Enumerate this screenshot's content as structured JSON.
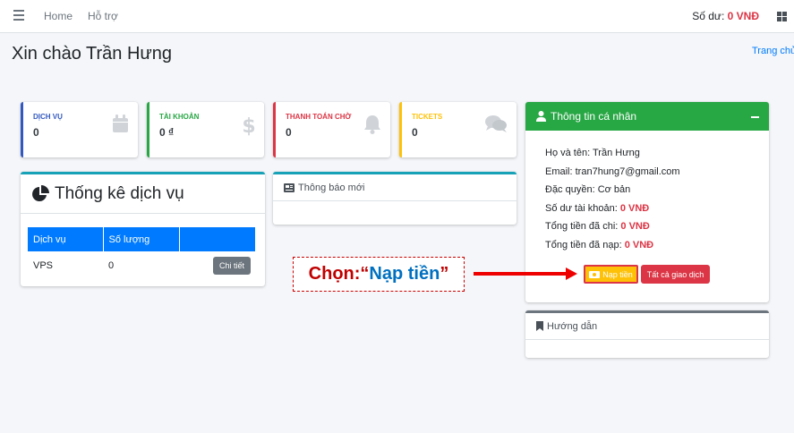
{
  "navbar": {
    "menu_icon": "hamburger-icon",
    "links": [
      "Home",
      "Hỗ trợ"
    ],
    "balance_label": "Số dư:",
    "balance_value": "0 VNĐ",
    "apps_icon": "grid-icon"
  },
  "page": {
    "title": "Xin chào Trần Hưng",
    "breadcrumb": "Trang chủ"
  },
  "stats": [
    {
      "label": "DỊCH VỤ",
      "value": "0",
      "color": "#3359c0",
      "icon": "calendar-icon"
    },
    {
      "label": "TÀI KHOẢN",
      "value": "0 ₫",
      "color": "#28a745",
      "icon": "dollar-icon"
    },
    {
      "label": "THANH TOÁN CHỜ",
      "value": "0",
      "color": "#dc3545",
      "icon": "bell-icon"
    },
    {
      "label": "TICKETS",
      "value": "0",
      "color": "#ffc107",
      "icon": "comments-icon"
    }
  ],
  "services": {
    "title": "Thống kê dịch vụ",
    "icon": "pie-chart-icon",
    "columns": [
      "Dịch vụ",
      "Số lượng",
      ""
    ],
    "rows": [
      {
        "name": "VPS",
        "count": "0",
        "action": "Chi tiết"
      }
    ]
  },
  "news": {
    "title": "Thông báo mới",
    "icon": "newspaper-icon"
  },
  "guide": {
    "title": "Hướng dẫn",
    "icon": "bookmark-icon"
  },
  "profile": {
    "title": "Thông tin cá nhân",
    "icon": "user-icon",
    "name_label": "Họ và tên:",
    "name_value": "Trần Hưng",
    "email_label": "Email:",
    "email_value": "tran7hung7@gmail.com",
    "privilege_label": "Đặc quyền:",
    "privilege_value": "Cơ bản",
    "balance_label": "Số dư tài khoản:",
    "balance_value": "0 VNĐ",
    "spent_label": "Tổng tiền đã chi:",
    "spent_value": "0 VNĐ",
    "deposited_label": "Tổng tiền đã nạp:",
    "deposited_value": "0 VNĐ",
    "deposit_button": "Nạp tiền",
    "all_transactions_button": "Tất cả giao dịch"
  },
  "annotation": {
    "prefix": "Chọn: ",
    "open_quote": "“",
    "highlight": "Nạp tiền",
    "close_quote": "”"
  }
}
